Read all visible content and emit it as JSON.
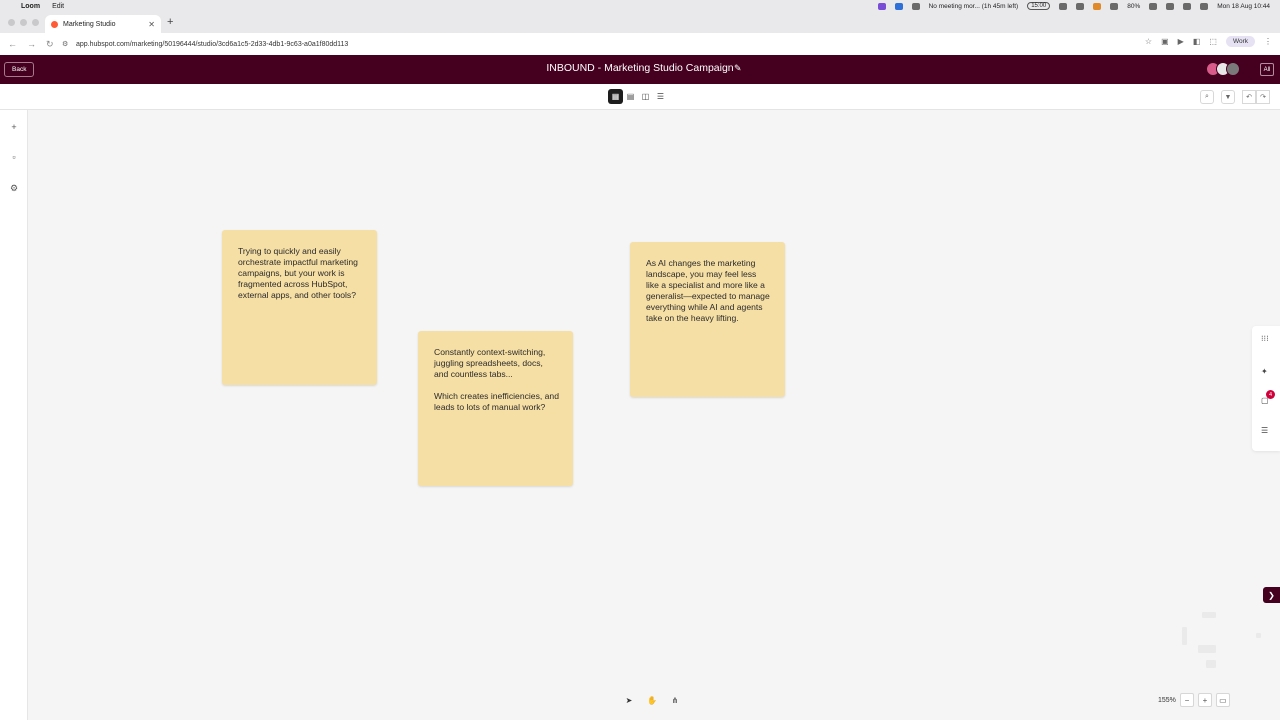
{
  "os_menu": {
    "app_name": "Loom",
    "menu_edit": "Edit",
    "meeting_status": "No meeting mor... (1h 45m left)",
    "time_pill": "15:00",
    "battery": "80%",
    "clock": "Mon 18 Aug 10:44"
  },
  "browser": {
    "tab_title": "Marketing Studio",
    "url": "app.hubspot.com/marketing/50196444/studio/3cd6a1c5-2d33-4db1-9c63-a0a1f80dd113",
    "profile_label": "Work"
  },
  "header": {
    "back_label": "Back",
    "title": "INBOUND - Marketing Studio Campaign",
    "panel_label": "All"
  },
  "notes": [
    {
      "text": "Trying to quickly and easily orchestrate impactful marketing campaigns, but your work is fragmented across HubSpot, external apps, and other tools?"
    },
    {
      "text": "Constantly context-switching, juggling spreadsheets, docs, and countless tabs...\n\nWhich creates inefficiencies, and leads to lots of manual work?"
    },
    {
      "text": "As AI changes the marketing landscape, you may feel less like a specialist and more like a generalist—expected to manage everything while AI and agents take on the heavy lifting."
    }
  ],
  "side_panel": {
    "notification_count": "4"
  },
  "zoom": {
    "level": "155%"
  }
}
